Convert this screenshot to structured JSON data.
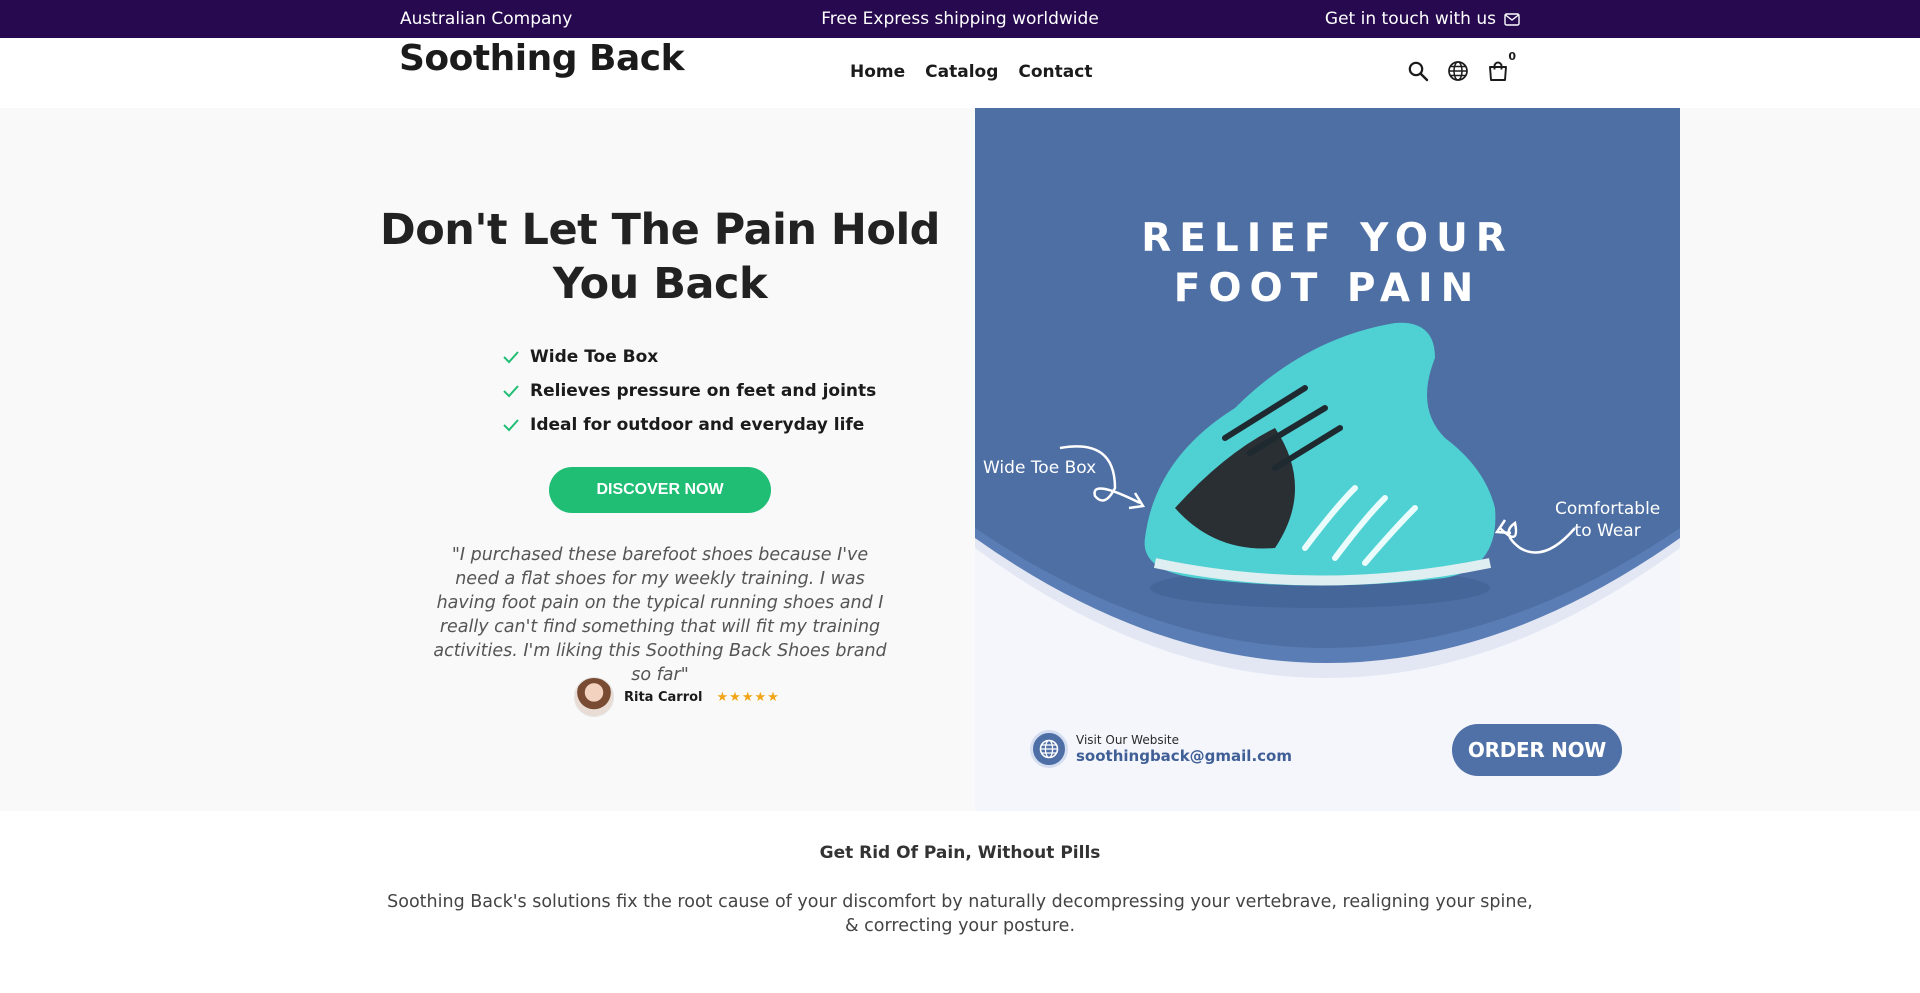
{
  "announcement": {
    "left": "Australian Company",
    "center": "Free Express shipping worldwide",
    "right": "Get in touch with us",
    "right_icon": "mail-icon"
  },
  "header": {
    "logo": "Soothing Back",
    "nav": [
      "Home",
      "Catalog",
      "Contact"
    ],
    "cart_count": "0",
    "icons": [
      "search-icon",
      "globe-icon",
      "shopping-bag-icon"
    ]
  },
  "hero": {
    "title": "Don't Let The Pain Hold You Back",
    "bullets": [
      "Wide Toe Box",
      "Relieves pressure on feet and joints",
      "Ideal for outdoor and everyday life"
    ],
    "cta": "DISCOVER NOW",
    "quote": "\"I purchased these barefoot shoes because I've need a flat shoes for my weekly training. I was having foot pain on the typical running shoes and I really can't find something that will fit my training activities. I'm liking this Soothing Back Shoes brand so far\"",
    "reviewer": "Rita Carrol",
    "rating_stars": "★★★★★",
    "rating": 5
  },
  "banner": {
    "title_line1": "RELIEF YOUR",
    "title_line2": "FOOT PAIN",
    "callout_left": "Wide Toe Box",
    "callout_right_line1": "Comfortable",
    "callout_right_line2": "to Wear",
    "visit_label": "Visit Our Website",
    "email": "soothingback@gmail.com",
    "order_button": "ORDER NOW",
    "colors": {
      "primary": "#4f71a8",
      "shoe": "#4fd0d2"
    }
  },
  "section": {
    "heading": "Get Rid Of Pain, Without Pills",
    "text": "Soothing Back's solutions fix the root cause of your discomfort by naturally decompressing your vertebrave, realigning your spine, & correcting your posture."
  },
  "colors": {
    "announcement_bg": "#27094f",
    "cta_green": "#1fbe74",
    "star": "#f2a516"
  }
}
